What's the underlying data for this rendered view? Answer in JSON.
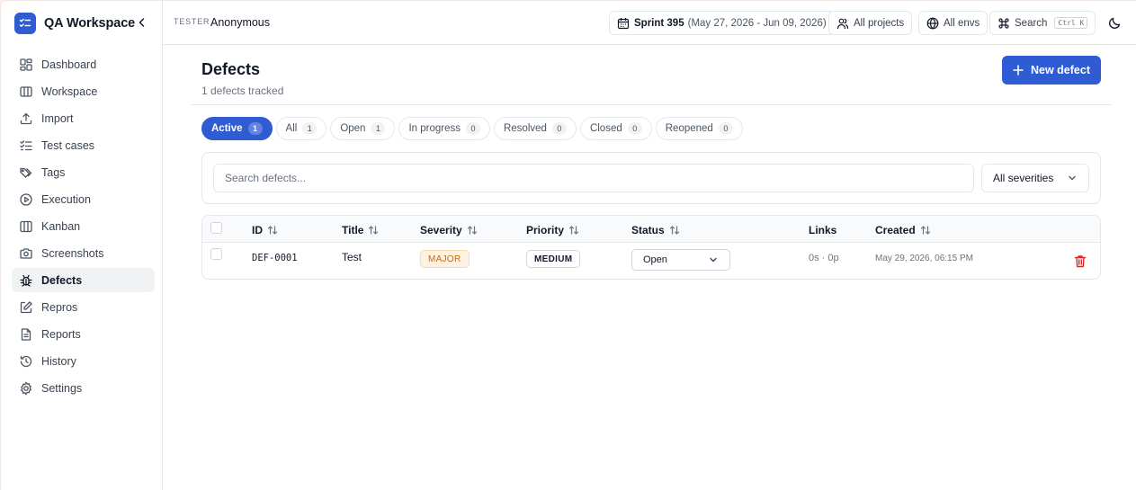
{
  "app": {
    "name": "QA Workspace"
  },
  "sidebar": {
    "items": [
      {
        "label": "Dashboard",
        "icon": "dashboard-icon"
      },
      {
        "label": "Workspace",
        "icon": "workspace-icon"
      },
      {
        "label": "Import",
        "icon": "upload-icon"
      },
      {
        "label": "Test cases",
        "icon": "checklist-icon"
      },
      {
        "label": "Tags",
        "icon": "tags-icon"
      },
      {
        "label": "Execution",
        "icon": "play-icon"
      },
      {
        "label": "Kanban",
        "icon": "kanban-icon"
      },
      {
        "label": "Screenshots",
        "icon": "camera-icon"
      },
      {
        "label": "Defects",
        "icon": "bug-icon",
        "active": true
      },
      {
        "label": "Repros",
        "icon": "edit-icon"
      },
      {
        "label": "Reports",
        "icon": "report-icon"
      },
      {
        "label": "History",
        "icon": "history-icon"
      },
      {
        "label": "Settings",
        "icon": "gear-icon"
      }
    ]
  },
  "topbar": {
    "role": "TESTER",
    "user": "Anonymous",
    "sprint_label": "Sprint 395",
    "sprint_range": "(May 27, 2026 - Jun 09, 2026)",
    "projects": "All projects",
    "envs": "All envs",
    "search": "Search",
    "shortcut": "Ctrl K"
  },
  "page": {
    "title": "Defects",
    "subtitle": "1 defects tracked",
    "new_button": "New defect"
  },
  "tabs": [
    {
      "label": "Active",
      "count": "1",
      "active": true
    },
    {
      "label": "All",
      "count": "1"
    },
    {
      "label": "Open",
      "count": "1"
    },
    {
      "label": "In progress",
      "count": "0"
    },
    {
      "label": "Resolved",
      "count": "0"
    },
    {
      "label": "Closed",
      "count": "0"
    },
    {
      "label": "Reopened",
      "count": "0"
    }
  ],
  "filters": {
    "search_placeholder": "Search defects...",
    "severity": "All severities"
  },
  "table": {
    "columns": [
      "ID",
      "Title",
      "Severity",
      "Priority",
      "Status",
      "Links",
      "Created"
    ],
    "rows": [
      {
        "id": "DEF-0001",
        "title": "Test",
        "severity": "MAJOR",
        "priority": "MEDIUM",
        "status": "Open",
        "links": "0s · 0p",
        "created": "May 29, 2026, 06:15 PM"
      }
    ]
  },
  "colors": {
    "accent": "#2f5bd3",
    "major_text": "#c2690f",
    "major_bg": "#fef3e2",
    "danger": "#dc2626"
  }
}
